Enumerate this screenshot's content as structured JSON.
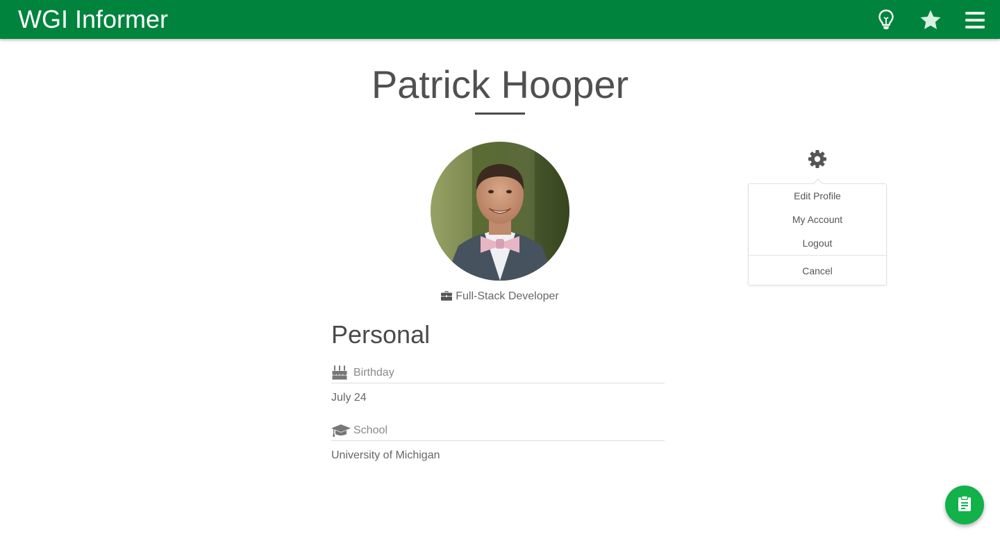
{
  "app": {
    "title": "WGI Informer",
    "brand_color": "#00843d",
    "accent_color": "#11b24a"
  },
  "header_icons": [
    "lightbulb-icon",
    "star-icon",
    "hamburger-menu-icon"
  ],
  "profile": {
    "name": "Patrick Hooper",
    "job_title": "Full-Stack Developer"
  },
  "personal": {
    "section_title": "Personal",
    "fields": [
      {
        "icon": "birthday-cake-icon",
        "label": "Birthday",
        "value": "July 24"
      },
      {
        "icon": "graduation-cap-icon",
        "label": "School",
        "value": "University of Michigan"
      }
    ]
  },
  "settings_menu": {
    "icon": "gear-icon",
    "items": [
      "Edit Profile",
      "My Account",
      "Logout"
    ],
    "cancel": "Cancel"
  },
  "fab": {
    "icon": "clipboard-icon"
  }
}
